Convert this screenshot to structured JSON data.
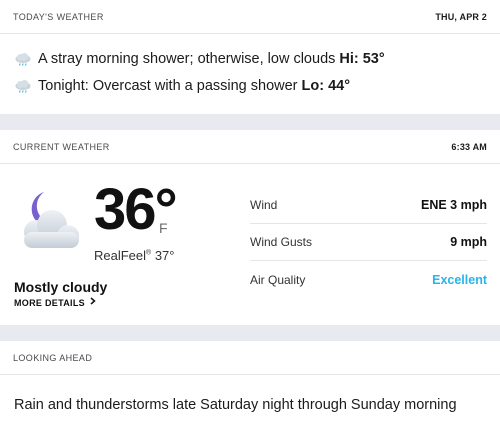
{
  "today": {
    "title": "TODAY'S WEATHER",
    "date": "THU, APR 2",
    "day": {
      "icon": "cloud-rain-icon",
      "text": "A stray morning shower; otherwise, low clouds",
      "hilo": "Hi: 53°"
    },
    "night": {
      "icon": "cloud-rain-icon",
      "text": "Tonight: Overcast with a passing shower",
      "hilo": "Lo: 44°"
    }
  },
  "current": {
    "title": "CURRENT WEATHER",
    "time": "6:33 AM",
    "icon": "moon-cloud-icon",
    "temperature": "36°",
    "unit": "F",
    "realfeel_label": "RealFeel",
    "realfeel_mark": "®",
    "realfeel_value": "37°",
    "phrase": "Mostly cloudy",
    "more_details": "MORE DETAILS",
    "details": [
      {
        "label": "Wind",
        "value": "ENE 3 mph"
      },
      {
        "label": "Wind Gusts",
        "value": "9 mph"
      },
      {
        "label": "Air Quality",
        "value": "Excellent"
      }
    ]
  },
  "ahead": {
    "title": "LOOKING AHEAD",
    "text": "Rain and thunderstorms late Saturday night through Sunday morning"
  },
  "colors": {
    "background": "#e8eaef",
    "card": "#ffffff",
    "air_quality_good": "#2ab4e8",
    "moon": "#7a5fd1"
  }
}
